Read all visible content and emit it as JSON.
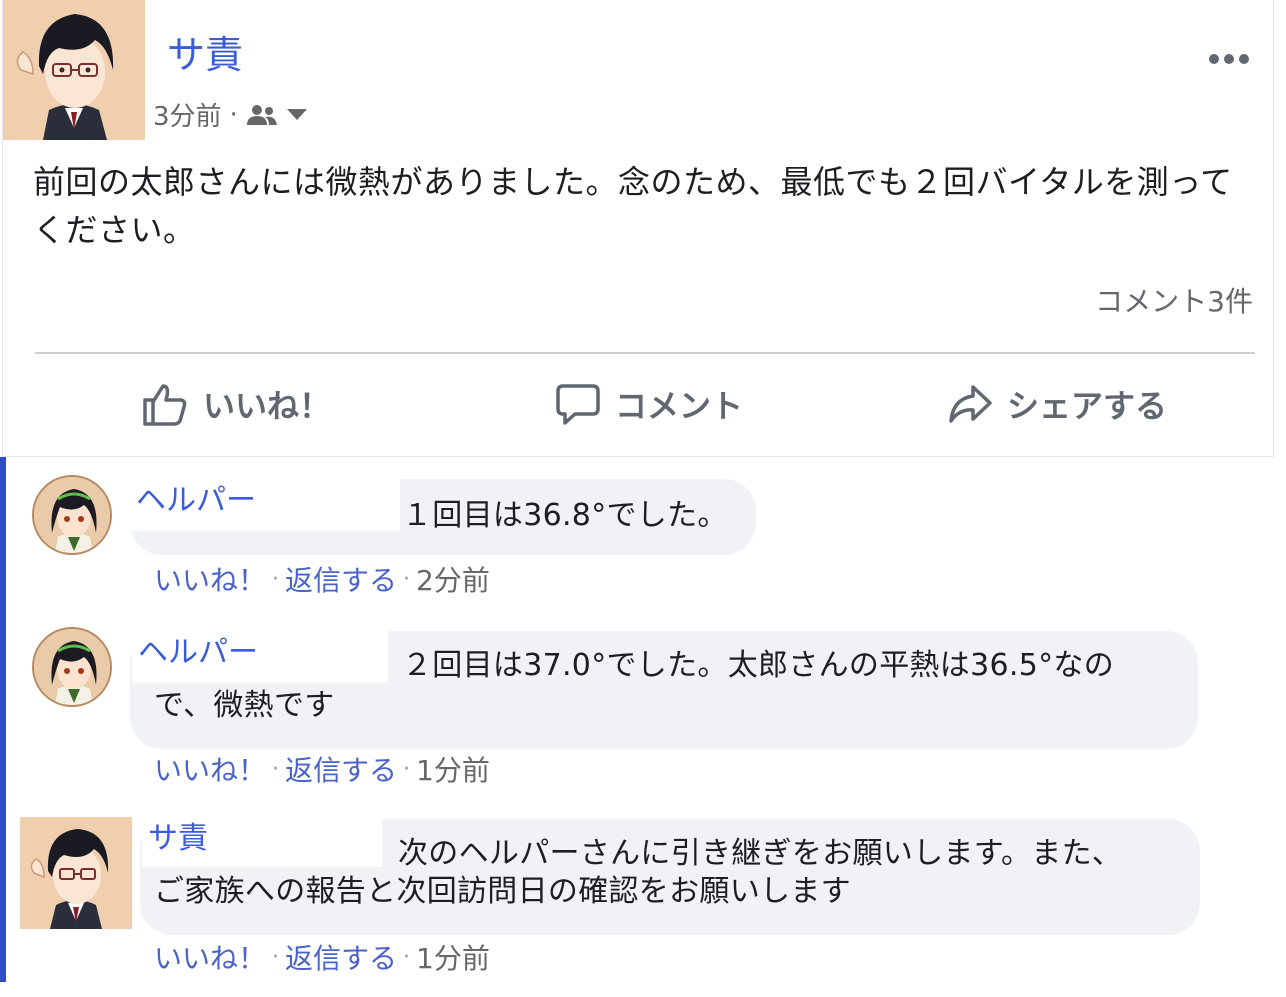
{
  "post": {
    "author": "サ責",
    "time": "3分前",
    "text": "前回の太郎さんには微熱がありました。念のため、最低でも２回バイタルを測ってください。",
    "comment_count": "コメント3件",
    "actions": {
      "like": "いいね！",
      "comment": "コメント",
      "share": "シェアする"
    },
    "icons": {
      "audience": "friends-icon",
      "audience_menu": "caret-down-icon",
      "more": "more-dots-icon",
      "like": "thumbs-up-icon",
      "comment": "speech-bubble-icon",
      "share": "share-arrow-icon"
    }
  },
  "comments": [
    {
      "author": "ヘルパー",
      "text_lines": [
        "１回目は36.8°でした。"
      ],
      "like_label": "いいね！",
      "reply_label": "返信する",
      "time": "2分前"
    },
    {
      "author": "ヘルパー",
      "text_lines": [
        "２回目は37.0°でした。太郎さんの平熱は36.5°なの",
        "で、微熱です"
      ],
      "like_label": "いいね！",
      "reply_label": "返信する",
      "time": "1分前"
    },
    {
      "author": "サ責",
      "text_lines": [
        "次のヘルパーさんに引き継ぎをお願いします。また、",
        "ご家族への報告と次回訪問日の確認をお願いします"
      ],
      "like_label": "いいね！",
      "reply_label": "返信する",
      "time": "1分前"
    }
  ],
  "colors": {
    "name_blue": "#3b5bdb",
    "link_blue": "#4a63c8",
    "thread_bar": "#2c4fc7",
    "bubble_bg": "#f0f2f5"
  }
}
